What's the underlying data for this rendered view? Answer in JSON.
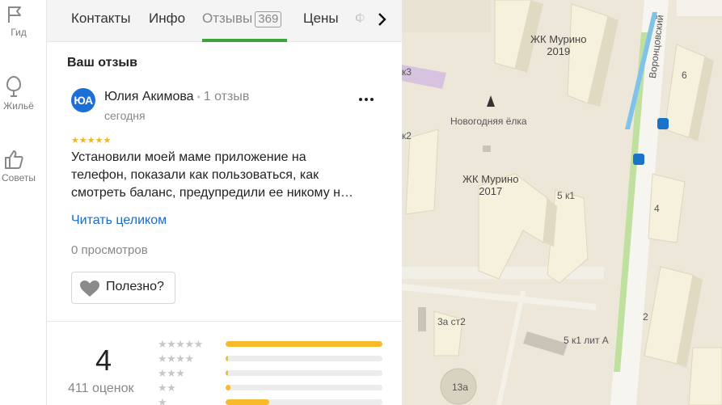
{
  "rail": {
    "items": [
      {
        "label": "Гид",
        "icon": "flag-icon"
      },
      {
        "label": "Жильё",
        "icon": "house-icon"
      },
      {
        "label": "Советы",
        "icon": "thumbs-up-icon"
      }
    ]
  },
  "tabs": {
    "items": [
      "Контакты",
      "Инфо",
      "Отзывы",
      "Цены",
      "Ф"
    ],
    "reviews_count": "369",
    "active_index": 2
  },
  "review": {
    "section_title": "Ваш отзыв",
    "avatar_initials": "ЮА",
    "author": "Юлия Акимова",
    "author_reviews": "1 отзыв",
    "date": "сегодня",
    "stars": "★★★★★",
    "text_lines": [
      "Установили моей маме приложение на",
      "телефон, показали как пользоваться, как",
      "смотреть баланс, предупредили ее никому н…"
    ],
    "read_more": "Читать целиком",
    "views": "0 просмотров",
    "useful_label": "Полезно?"
  },
  "rating": {
    "value": "4",
    "count": "411 оценок",
    "distribution": [
      {
        "stars": "★★★★★",
        "fraction": 1.0
      },
      {
        "stars": "★★★★",
        "fraction": 0.01
      },
      {
        "stars": "★★★",
        "fraction": 0.01
      },
      {
        "stars": "★★",
        "fraction": 0.03
      },
      {
        "stars": "★",
        "fraction": 0.28
      }
    ]
  },
  "map": {
    "labels": {
      "murino_2019_name": "ЖК Мурино",
      "murino_2019_year": "2019",
      "murino_2017_name": "ЖК Мурино",
      "murino_2017_year": "2017",
      "tree": "Новогодняя ёлка",
      "street": "Воронцовский",
      "b_5k1": "5 к1",
      "b_5k1_lit_a": "5 к1 лит А",
      "b_3a_st2": "3а ст2",
      "b_13a": "13а",
      "b_6": "6",
      "b_4": "4",
      "b_2": "2",
      "b_k2": "к2",
      "b_k3": "к3"
    }
  },
  "colors": {
    "accent_green": "#3ba43b",
    "star_yellow": "#f8b92a",
    "link_blue": "#1a6bc9",
    "avatar_blue": "#1b6fd6"
  }
}
